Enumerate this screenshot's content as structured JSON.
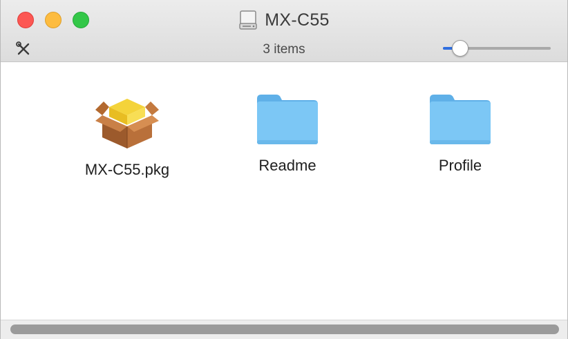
{
  "window": {
    "title": "MX-C55",
    "title_icon": "disk-icon"
  },
  "toolbar": {
    "item_count": "3 items",
    "tools_icon": "tools-icon",
    "icon_size_slider": {
      "value": 0.16
    }
  },
  "files": [
    {
      "name": "MX-C55.pkg",
      "icon": "package-icon"
    },
    {
      "name": "Readme",
      "icon": "folder-icon"
    },
    {
      "name": "Profile",
      "icon": "folder-icon"
    }
  ],
  "colors": {
    "close": "#fc5753",
    "minimize": "#fdbc40",
    "maximize": "#33c748",
    "folder": "#7cc7f5",
    "accent": "#2f6fe0"
  }
}
